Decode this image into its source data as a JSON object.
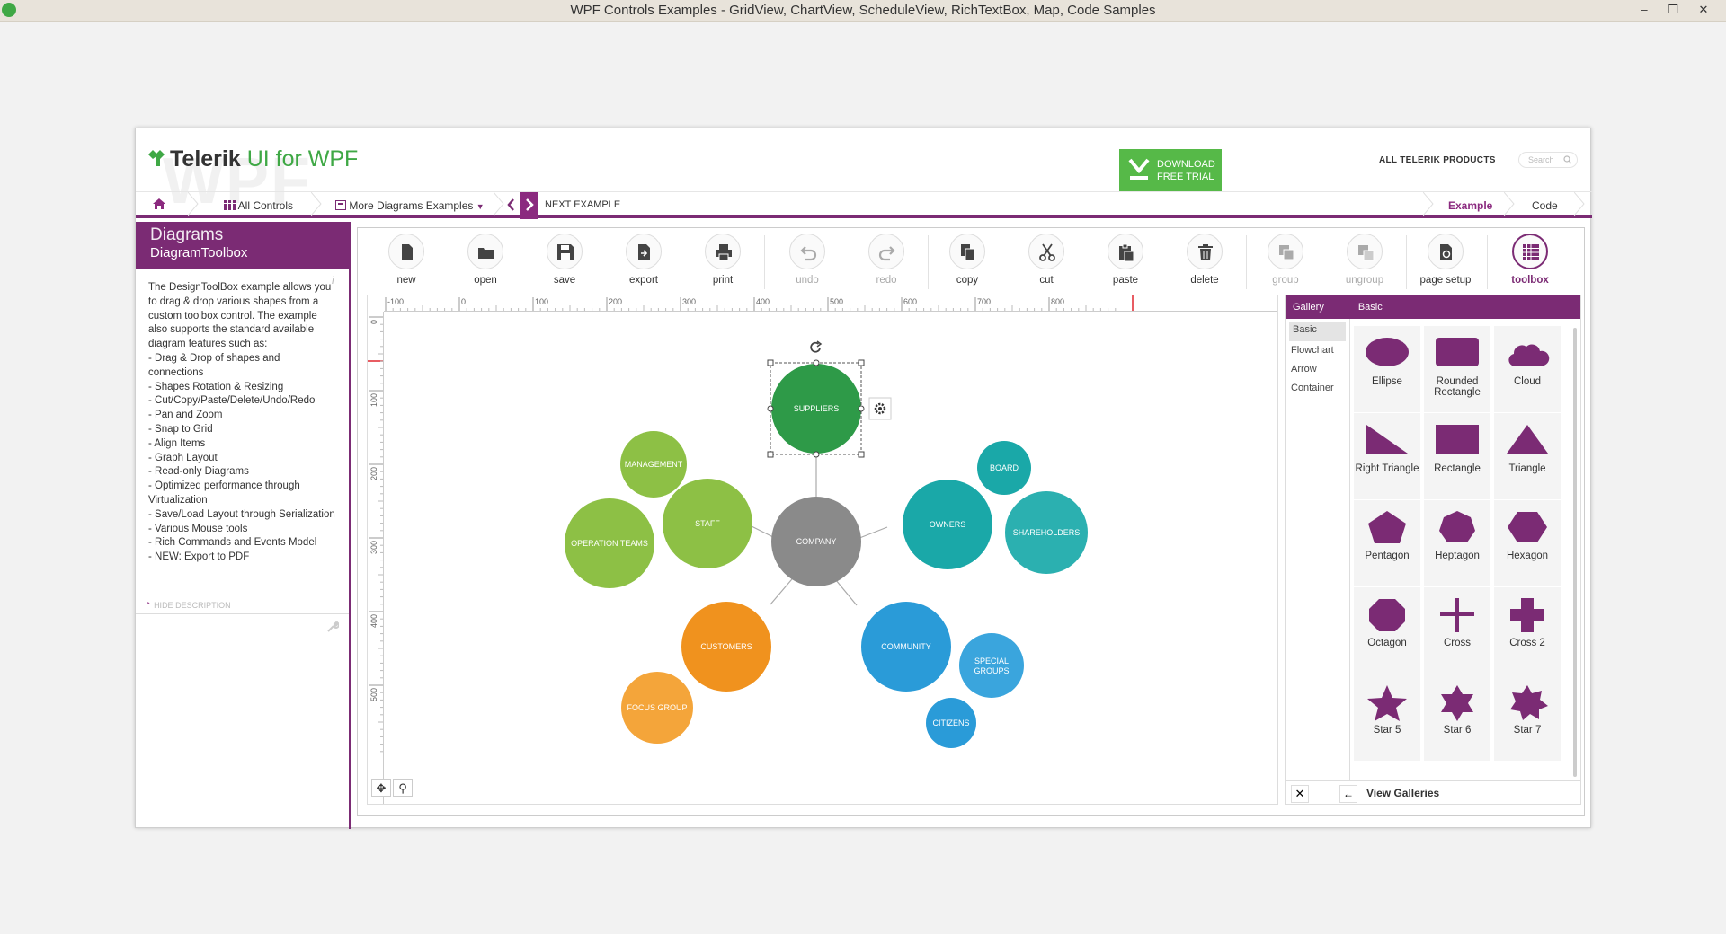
{
  "window": {
    "title": "WPF Controls Examples - GridView, ChartView, ScheduleView, RichTextBox, Map, Code Samples",
    "controls": [
      "–",
      "❐",
      "✕"
    ]
  },
  "header": {
    "logo_brand": "Telerik",
    "logo_product": "UI for WPF",
    "watermark": "WPF",
    "download_line1": "DOWNLOAD",
    "download_line2": "FREE TRIAL",
    "all_products": "ALL TELERIK PRODUCTS",
    "search_placeholder": "Search"
  },
  "nav": {
    "all_controls": "All Controls",
    "more_examples": "More Diagrams Examples",
    "next_example": "NEXT EXAMPLE",
    "tab_example": "Example",
    "tab_code": "Code"
  },
  "left": {
    "title": "Diagrams",
    "subtitle": "DiagramToolbox",
    "description": "The DesignToolBox example allows you to drag & drop various shapes from a custom toolbox control. The example also supports the standard available diagram features such as:\n- Drag & Drop of shapes and connections\n- Shapes Rotation & Resizing\n- Cut/Copy/Paste/Delete/Undo/Redo\n- Pan and Zoom\n- Snap to Grid\n- Align Items\n- Graph Layout\n- Read-only Diagrams\n- Optimized performance through Virtualization\n- Save/Load Layout through Serialization\n- Various Mouse tools\n- Rich Commands and Events Model\n- NEW: Export to PDF",
    "hide_description": "HIDE DESCRIPTION"
  },
  "toolbar": {
    "new": "new",
    "open": "open",
    "save": "save",
    "export": "export",
    "print": "print",
    "undo": "undo",
    "redo": "redo",
    "copy": "copy",
    "cut": "cut",
    "paste": "paste",
    "delete": "delete",
    "group": "group",
    "ungroup": "ungroup",
    "page_setup": "page setup",
    "toolbox": "toolbox"
  },
  "ruler": {
    "h_ticks": [
      "-100",
      "0",
      "100",
      "200",
      "300",
      "400",
      "500",
      "600",
      "700",
      "800"
    ],
    "v_ticks": [
      "0",
      "100",
      "200",
      "300",
      "400",
      "500"
    ]
  },
  "diagram": {
    "nodes": {
      "suppliers": "SUPPLIERS",
      "management": "MANAGEMENT",
      "staff": "STAFF",
      "operation_teams": "OPERATION TEAMS",
      "company": "COMPANY",
      "board": "BOARD",
      "owners": "OWNERS",
      "shareholders": "SHAREHOLDERS",
      "customers": "CUSTOMERS",
      "focus_group": "FOCUS GROUP",
      "community": "COMMUNITY",
      "special_groups_1": "SPECIAL",
      "special_groups_2": "GROUPS",
      "citizens": "CITIZENS"
    },
    "colors": {
      "green_dark": "#2e9a48",
      "green_light": "#8dc045",
      "gray": "#8a8a8a",
      "teal": "#1aa8a8",
      "orange": "#f0921e",
      "blue": "#2a9bd8"
    }
  },
  "toolbox_panel": {
    "header_gallery": "Gallery",
    "header_selected": "Basic",
    "galleries": [
      "Basic",
      "Flowchart",
      "Arrow",
      "Container"
    ],
    "shapes": [
      {
        "label": "Ellipse",
        "icon": "ellipse-icon"
      },
      {
        "label": "Rounded Rectangle",
        "icon": "rounded-rectangle-icon"
      },
      {
        "label": "Cloud",
        "icon": "cloud-icon"
      },
      {
        "label": "Right Triangle",
        "icon": "right-triangle-icon"
      },
      {
        "label": "Rectangle",
        "icon": "rectangle-icon"
      },
      {
        "label": "Triangle",
        "icon": "triangle-icon"
      },
      {
        "label": "Pentagon",
        "icon": "pentagon-icon"
      },
      {
        "label": "Heptagon",
        "icon": "heptagon-icon"
      },
      {
        "label": "Hexagon",
        "icon": "hexagon-icon"
      },
      {
        "label": "Octagon",
        "icon": "octagon-icon"
      },
      {
        "label": "Cross",
        "icon": "cross-icon"
      },
      {
        "label": "Cross 2",
        "icon": "cross2-icon"
      },
      {
        "label": "Star 5",
        "icon": "star5-icon"
      },
      {
        "label": "Star 6",
        "icon": "star6-icon"
      },
      {
        "label": "Star 7",
        "icon": "star7-icon"
      }
    ],
    "view_galleries": "View Galleries",
    "shape_color": "#7b2b74"
  }
}
